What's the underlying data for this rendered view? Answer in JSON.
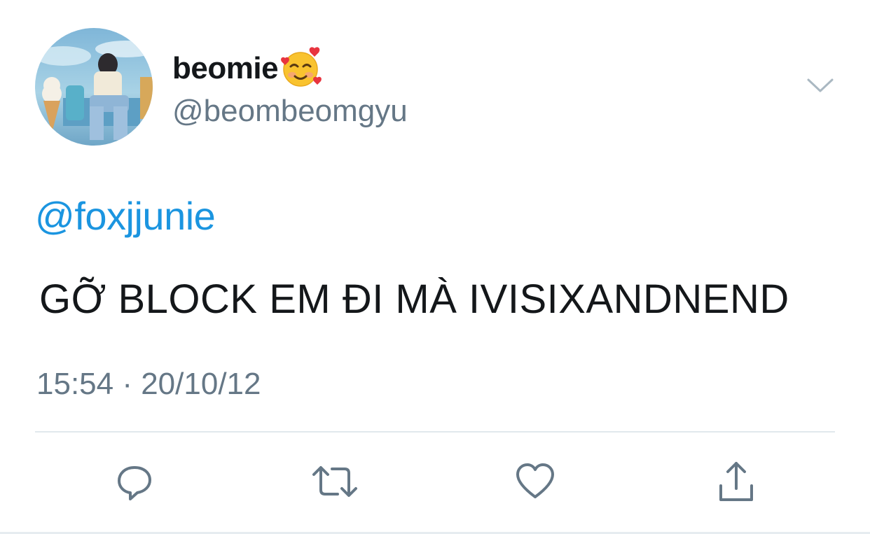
{
  "tweet": {
    "display_name": "beomie",
    "emoji": "smiling-face-with-hearts",
    "handle": "@beombeomgyu",
    "mention": "@foxjjunie",
    "text": "GỠ BLOCK EM ĐI MÀ IVISIXANDNEND",
    "timestamp": "15:54 · 20/10/12"
  },
  "actions": [
    {
      "name": "reply",
      "icon": "reply-icon"
    },
    {
      "name": "retweet",
      "icon": "retweet-icon"
    },
    {
      "name": "like",
      "icon": "heart-icon"
    },
    {
      "name": "share",
      "icon": "share-icon"
    }
  ],
  "colors": {
    "text": "#14171a",
    "secondary": "#657786",
    "link": "#1b95e0",
    "divider": "#e1e8ed"
  }
}
